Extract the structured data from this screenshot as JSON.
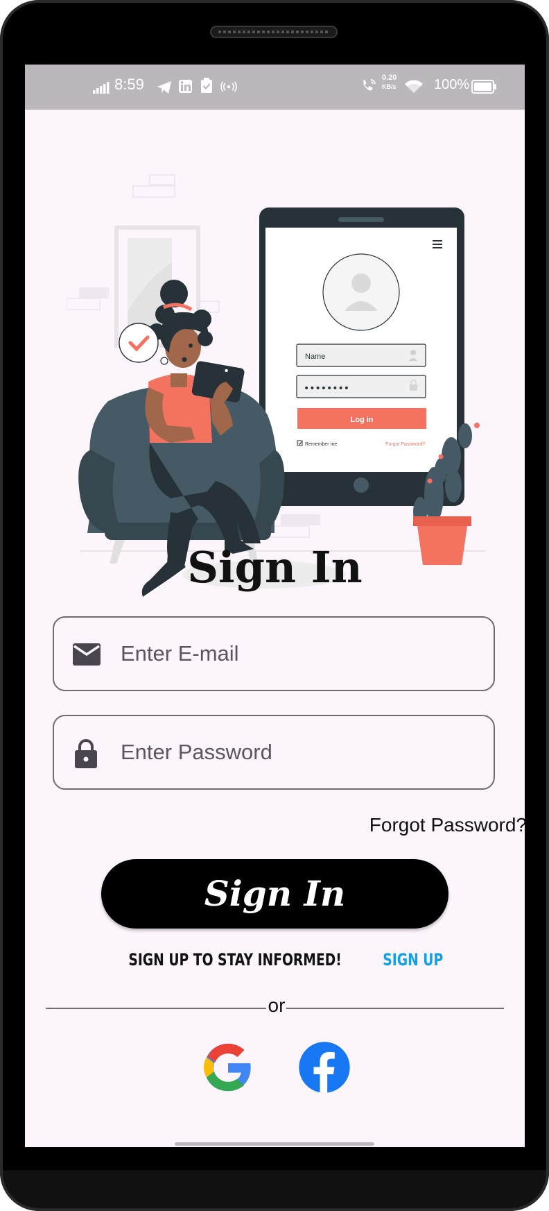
{
  "status_bar": {
    "time": "8:59",
    "network_speed_top": "0.20",
    "network_speed_unit": "KB/s",
    "battery": "100%",
    "icons": [
      "signal-icon",
      "telegram-icon",
      "linkedin-icon",
      "clipboard-check-icon",
      "broadcast-icon",
      "wifi-call-icon",
      "wifi-icon",
      "battery-icon"
    ]
  },
  "illustration": {
    "phone_name_field": "Name",
    "phone_password_mask": "••••••••",
    "phone_login_button": "Log in",
    "phone_remember": "Remember me",
    "phone_forgot": "Forgot Password?"
  },
  "page": {
    "title": "Sign In",
    "email_placeholder": "Enter E-mail",
    "password_placeholder": "Enter Password",
    "forgot_password": "Forgot Password?",
    "signin_button": "Sign In",
    "signup_prompt": "SIGN UP TO STAY INFORMED!",
    "signup_link": "SIGN UP",
    "or_text": "or"
  },
  "social": [
    "google-icon",
    "facebook-icon"
  ],
  "colors": {
    "background": "#fcf5fc",
    "accent_coral": "#f47260",
    "link_blue": "#13a0e6",
    "facebook_blue": "#1877f2",
    "dark": "#263238"
  }
}
